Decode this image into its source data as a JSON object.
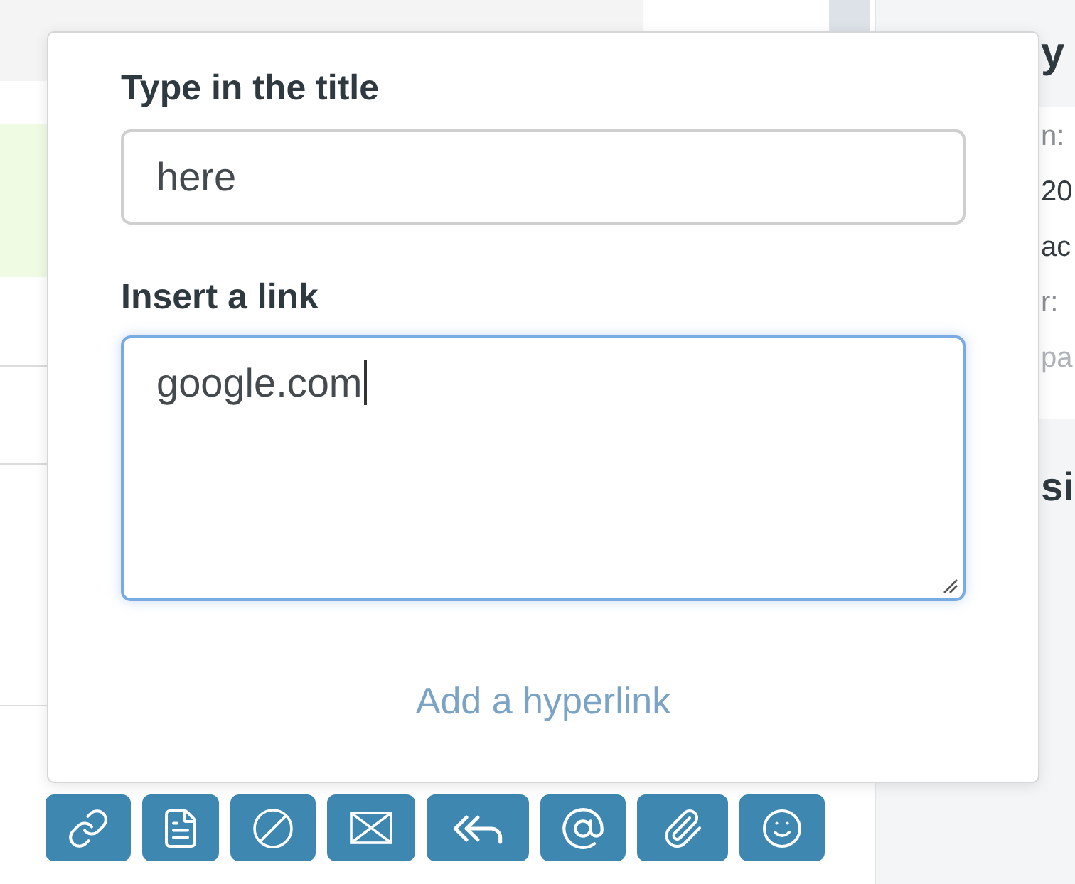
{
  "background_list": {
    "rows": [
      {
        "selected": true
      },
      {
        "selected": false
      },
      {
        "selected": false
      },
      {
        "selected": false
      }
    ]
  },
  "link_dialog": {
    "fields": [
      {
        "kind": "input",
        "label": "Type in the title",
        "value": "here",
        "focused": false
      },
      {
        "kind": "textarea",
        "label": "Insert a link",
        "value": "google.com",
        "focused": true
      }
    ],
    "submit_link": "Add a hyperlink"
  },
  "side_panel": {
    "heading": "y",
    "details": [
      {
        "kind": "label",
        "text": "n:"
      },
      {
        "kind": "value",
        "text": "20"
      },
      {
        "kind": "value",
        "text": "ac"
      },
      {
        "kind": "label",
        "text": "r:"
      },
      {
        "kind": "hint",
        "text": "pa"
      }
    ],
    "section_heading": "si"
  }
}
